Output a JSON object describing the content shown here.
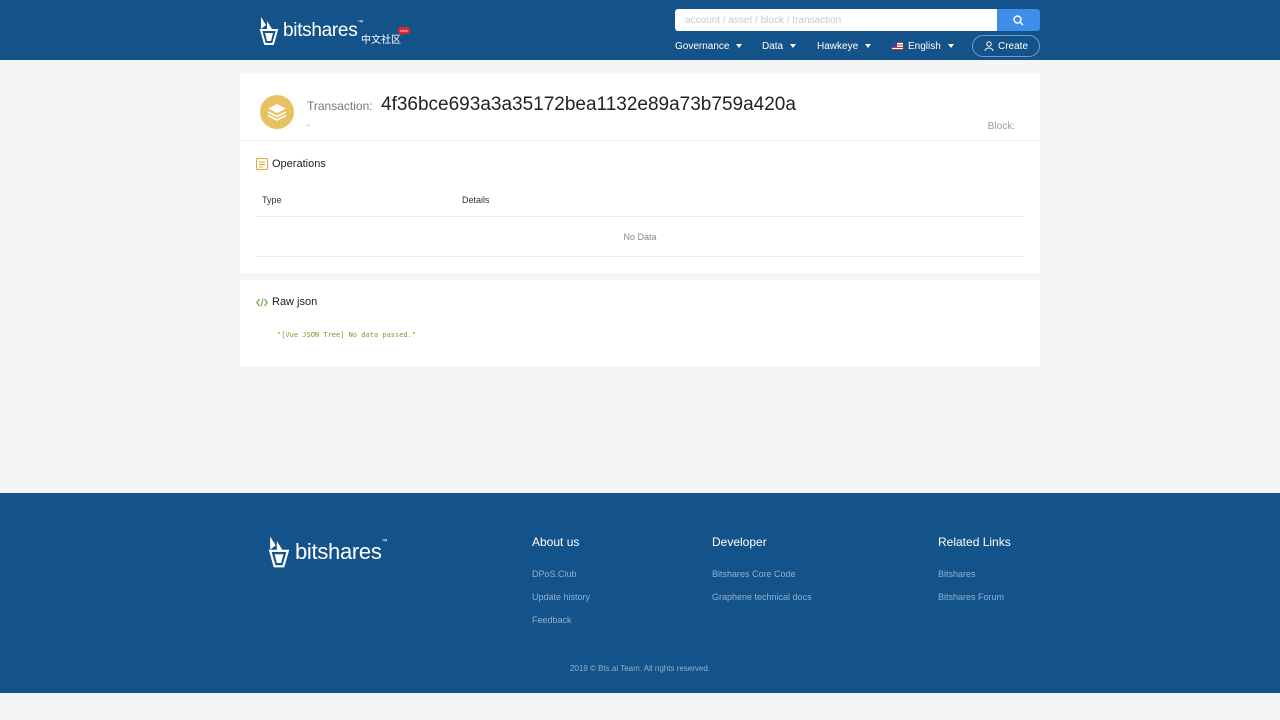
{
  "header": {
    "brand": "bitshares",
    "brand_mark": "™",
    "community_link": "中文社区",
    "hot_badge": "new",
    "search": {
      "placeholder": "account / asset / block / transaction"
    },
    "nav": [
      {
        "label": "Governance"
      },
      {
        "label": "Data"
      },
      {
        "label": "Hawkeye"
      },
      {
        "label": "English"
      }
    ],
    "create_label": "Create"
  },
  "transaction": {
    "label": "Transaction:",
    "hash": "4f36bce693a3a35172bea1132e89a73b759a420a",
    "subtitle": "-",
    "block_label": "Block:"
  },
  "operations": {
    "title": "Operations",
    "columns": [
      "Type",
      "Details"
    ],
    "empty_text": "No Data"
  },
  "raw": {
    "title": "Raw json",
    "content": "\"[Vue JSON Tree] No data passed.\""
  },
  "footer": {
    "brand": "bitshares",
    "brand_mark": "™",
    "columns": [
      {
        "title": "About us",
        "links": [
          "DPoS.Club",
          "Update history",
          "Feedback"
        ]
      },
      {
        "title": "Developer",
        "links": [
          "Bitshares Core Code",
          "Graphene technical docs"
        ]
      },
      {
        "title": "Related Links",
        "links": [
          "Bitshares",
          "Bitshares Forum"
        ]
      }
    ],
    "copyright": "2019 © Bts.ai Team. All rights reserved."
  },
  "colors": {
    "primary": "#14538a",
    "search_button": "#3d8ee6",
    "tx_icon": "#e8c160",
    "json_text": "#7d9b2d"
  },
  "icons": [
    "bitshares-logo-icon",
    "search-icon",
    "caret-down-icon",
    "us-flag-icon",
    "user-icon",
    "layers-icon",
    "list-icon",
    "code-icon"
  ]
}
